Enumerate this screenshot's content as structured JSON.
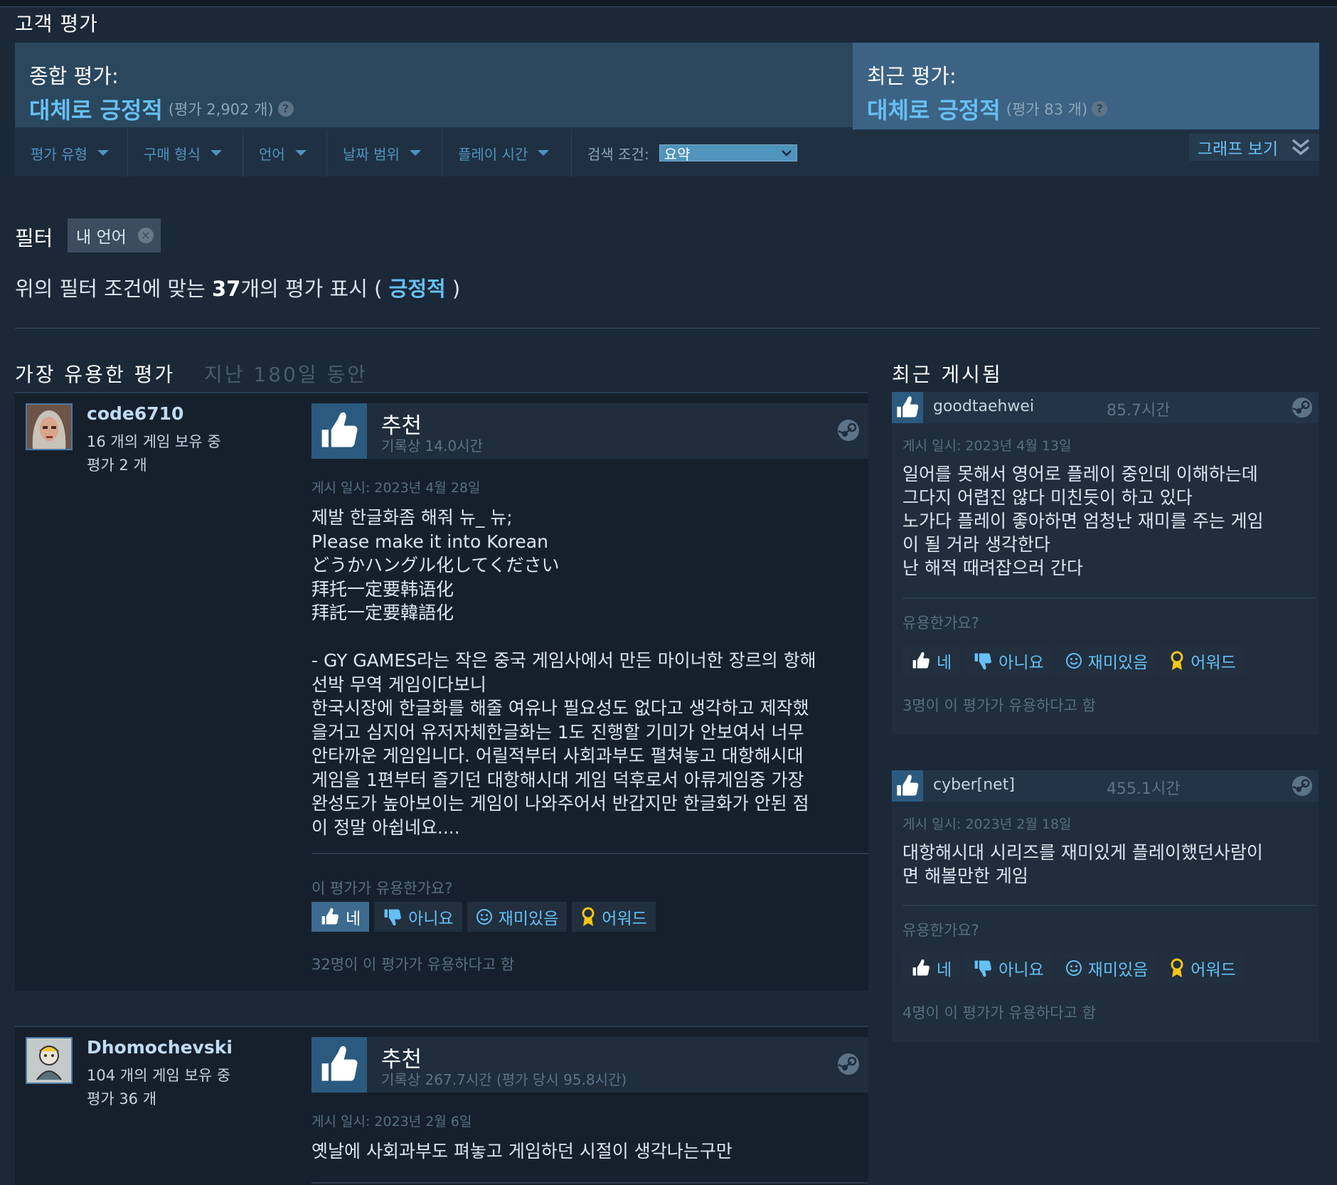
{
  "section_title": "고객 평가",
  "summary": {
    "overall_label": "종합 평가:",
    "overall_rating": "대체로 긍정적",
    "overall_count": "(평가 2,902 개)",
    "recent_label": "최근 평가:",
    "recent_rating": "대체로 긍정적",
    "recent_count": "(평가 83 개)",
    "help_glyph": "?"
  },
  "filters": {
    "review_type": "평가 유형",
    "purchase_type": "구매 형식",
    "language": "언어",
    "date_range": "날짜 범위",
    "playtime": "플레이 시간",
    "search_label": "검색 조건:",
    "search_value": "요약",
    "graph_button": "그래프 보기"
  },
  "active_filter": {
    "label": "필터",
    "chip": "내 언어",
    "chip_close": "×"
  },
  "result": {
    "prefix": "위의 필터 조건에 맞는",
    "count": "37",
    "middle": "개의 평가 표시 (",
    "sentiment": "긍정적",
    "suffix": ")"
  },
  "helpful_header": {
    "title": "가장 유용한 평가",
    "subtitle": "지난 180일 동안"
  },
  "recent_header": "최근 게시됨",
  "vote_labels": {
    "yes": "네",
    "no": "아니요",
    "funny": "재미있음",
    "award": "어워드"
  },
  "reviews": [
    {
      "username": "code6710",
      "games_owned": "16 개의 게임 보유 중",
      "reviews_count": "평가 2 개",
      "recommendation": "추천",
      "hours": "기록상 14.0시간",
      "posted": "게시 일시: 2023년 4월 28일",
      "text": "제발 한글화좀 해줘 뉴_ 뉴;\nPlease make it into Korean\nどうかハングル化してください\n拜托一定要韩语化\n拜託一定要韓語化\n\n- GY GAMES라는 작은 중국 게임사에서 만든 마이너한 장르의 항해\n선박 무역 게임이다보니\n한국시장에 한글화를 해줄 여유나 필요성도 없다고 생각하고 제작했\n을거고 심지어 유저자체한글화는 1도 진행할 기미가 안보여서 너무\n안타까운 게임입니다. 어릴적부터 사회과부도 펼쳐놓고 대항해시대\n게임을 1편부터 즐기던 대항해시대 게임 덕후로서 아류게임중 가장\n완성도가 높아보이는 게임이 나와주어서 반갑지만 한글화가 안된 점\n이 정말 아쉽네요....",
      "helpful_q": "이 평가가 유용한가요?",
      "found_helpful": "32명이 이 평가가 유용하다고 함"
    },
    {
      "username": "Dhomochevski",
      "games_owned": "104 개의 게임 보유 중",
      "reviews_count": "평가 36 개",
      "recommendation": "추천",
      "hours": "기록상 267.7시간 (평가 당시 95.8시간)",
      "posted": "게시 일시: 2023년 2월 6일",
      "text": "옛날에 사회과부도 펴놓고 게임하던 시절이 생각나는구만"
    }
  ],
  "recent_reviews": [
    {
      "username": "goodtaehwei",
      "hours": "85.7시간",
      "posted": "게시 일시: 2023년 4월 13일",
      "text": "일어를 못해서 영어로 플레이 중인데 이해하는데\n그다지 어렵진 않다 미친듯이 하고 있다\n노가다 플레이 좋아하면 엄청난 재미를 주는 게임\n이 될 거라 생각한다\n난 해적 때려잡으러 간다",
      "helpful_q": "유용한가요?",
      "found_helpful": "3명이 이 평가가 유용하다고 함"
    },
    {
      "username": "cyber[net]",
      "hours": "455.1시간",
      "posted": "게시 일시: 2023년 2월 18일",
      "text": "대항해시대 시리즈를 재미있게 플레이했던사람이\n면 해볼만한 게임",
      "helpful_q": "유용한가요?",
      "found_helpful": "4명이 이 평가가 유용하다고 함"
    }
  ],
  "colors": {
    "accent": "#66c0f4",
    "background": "#1b2838",
    "summary_left": "#2a475e",
    "summary_right": "#3c6384",
    "award": "#f5c518"
  }
}
